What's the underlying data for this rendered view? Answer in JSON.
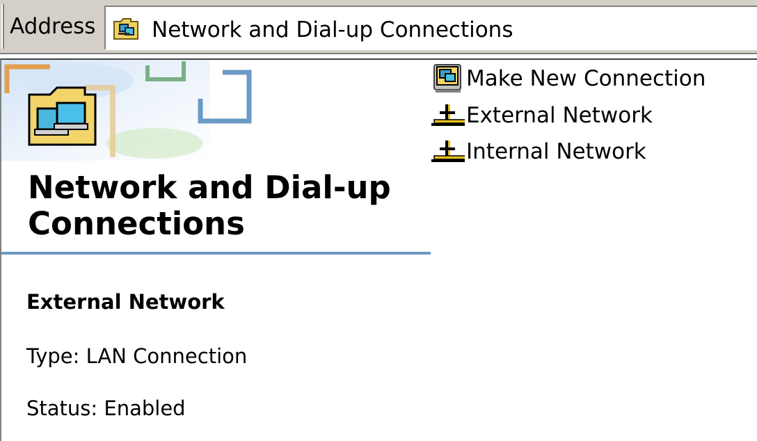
{
  "address_bar": {
    "label": "Address",
    "path": "Network and Dial-up Connections",
    "icon": "network-folder-icon"
  },
  "webview": {
    "title": "Network and Dial-up Connections",
    "banner_icon": "network-connections-folder-icon",
    "accent_color": "#6b9ac4",
    "selected": {
      "name": "External Network",
      "type": "Type: LAN Connection",
      "status": "Status: Enabled"
    }
  },
  "items": [
    {
      "label": "Make New Connection",
      "icon": "make-new-connection-icon"
    },
    {
      "label": "External Network",
      "icon": "lan-connection-icon"
    },
    {
      "label": "Internal Network",
      "icon": "lan-connection-icon"
    }
  ]
}
